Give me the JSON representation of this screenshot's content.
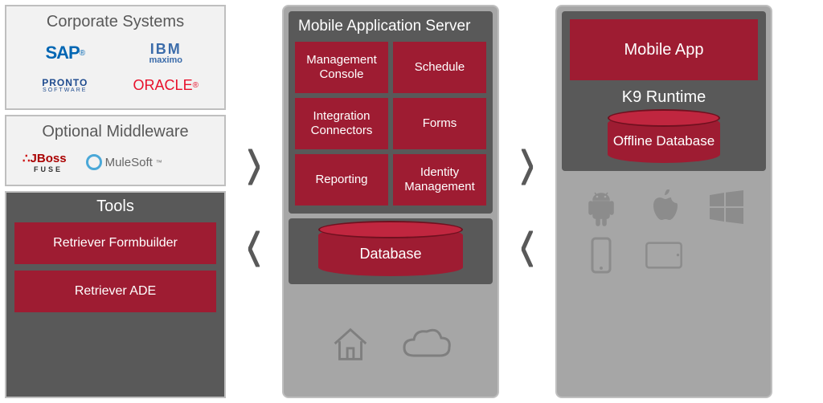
{
  "left": {
    "corporate": {
      "title": "Corporate Systems",
      "logos": {
        "sap": "SAP",
        "ibm": "IBM",
        "ibm_sub": "maximo",
        "pronto": "PRONTO",
        "pronto_sub": "SOFTWARE",
        "oracle": "ORACLE"
      }
    },
    "middleware": {
      "title": "Optional Middleware",
      "logos": {
        "jboss": "JBoss",
        "jboss_sub": "FUSE",
        "mulesoft": "MuleSoft"
      }
    },
    "tools": {
      "title": "Tools",
      "items": [
        "Retriever Formbuilder",
        "Retriever ADE"
      ]
    }
  },
  "center": {
    "title": "Mobile Application Server",
    "modules": [
      "Management Console",
      "Schedule",
      "Integration Connectors",
      "Forms",
      "Reporting",
      "Identity Management"
    ],
    "database": "Database",
    "footer_icons": [
      "home-icon",
      "cloud-icon"
    ]
  },
  "right": {
    "app": "Mobile App",
    "runtime": "K9 Runtime",
    "offline_db": "Offline Database",
    "platforms": [
      "android-icon",
      "apple-icon",
      "windows-icon",
      "phone-icon",
      "tablet-icon"
    ]
  },
  "colors": {
    "red": "#9e1c32",
    "dark": "#595959",
    "mid": "#a6a6a6",
    "light": "#f2f2f2"
  }
}
